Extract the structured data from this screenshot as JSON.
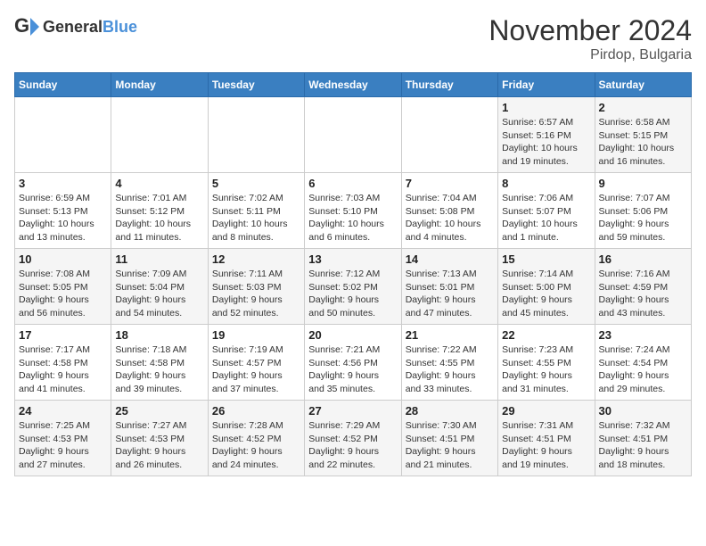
{
  "header": {
    "logo_general": "General",
    "logo_blue": "Blue",
    "month": "November 2024",
    "location": "Pirdop, Bulgaria"
  },
  "weekdays": [
    "Sunday",
    "Monday",
    "Tuesday",
    "Wednesday",
    "Thursday",
    "Friday",
    "Saturday"
  ],
  "weeks": [
    [
      {
        "day": "",
        "info": ""
      },
      {
        "day": "",
        "info": ""
      },
      {
        "day": "",
        "info": ""
      },
      {
        "day": "",
        "info": ""
      },
      {
        "day": "",
        "info": ""
      },
      {
        "day": "1",
        "info": "Sunrise: 6:57 AM\nSunset: 5:16 PM\nDaylight: 10 hours\nand 19 minutes."
      },
      {
        "day": "2",
        "info": "Sunrise: 6:58 AM\nSunset: 5:15 PM\nDaylight: 10 hours\nand 16 minutes."
      }
    ],
    [
      {
        "day": "3",
        "info": "Sunrise: 6:59 AM\nSunset: 5:13 PM\nDaylight: 10 hours\nand 13 minutes."
      },
      {
        "day": "4",
        "info": "Sunrise: 7:01 AM\nSunset: 5:12 PM\nDaylight: 10 hours\nand 11 minutes."
      },
      {
        "day": "5",
        "info": "Sunrise: 7:02 AM\nSunset: 5:11 PM\nDaylight: 10 hours\nand 8 minutes."
      },
      {
        "day": "6",
        "info": "Sunrise: 7:03 AM\nSunset: 5:10 PM\nDaylight: 10 hours\nand 6 minutes."
      },
      {
        "day": "7",
        "info": "Sunrise: 7:04 AM\nSunset: 5:08 PM\nDaylight: 10 hours\nand 4 minutes."
      },
      {
        "day": "8",
        "info": "Sunrise: 7:06 AM\nSunset: 5:07 PM\nDaylight: 10 hours\nand 1 minute."
      },
      {
        "day": "9",
        "info": "Sunrise: 7:07 AM\nSunset: 5:06 PM\nDaylight: 9 hours\nand 59 minutes."
      }
    ],
    [
      {
        "day": "10",
        "info": "Sunrise: 7:08 AM\nSunset: 5:05 PM\nDaylight: 9 hours\nand 56 minutes."
      },
      {
        "day": "11",
        "info": "Sunrise: 7:09 AM\nSunset: 5:04 PM\nDaylight: 9 hours\nand 54 minutes."
      },
      {
        "day": "12",
        "info": "Sunrise: 7:11 AM\nSunset: 5:03 PM\nDaylight: 9 hours\nand 52 minutes."
      },
      {
        "day": "13",
        "info": "Sunrise: 7:12 AM\nSunset: 5:02 PM\nDaylight: 9 hours\nand 50 minutes."
      },
      {
        "day": "14",
        "info": "Sunrise: 7:13 AM\nSunset: 5:01 PM\nDaylight: 9 hours\nand 47 minutes."
      },
      {
        "day": "15",
        "info": "Sunrise: 7:14 AM\nSunset: 5:00 PM\nDaylight: 9 hours\nand 45 minutes."
      },
      {
        "day": "16",
        "info": "Sunrise: 7:16 AM\nSunset: 4:59 PM\nDaylight: 9 hours\nand 43 minutes."
      }
    ],
    [
      {
        "day": "17",
        "info": "Sunrise: 7:17 AM\nSunset: 4:58 PM\nDaylight: 9 hours\nand 41 minutes."
      },
      {
        "day": "18",
        "info": "Sunrise: 7:18 AM\nSunset: 4:58 PM\nDaylight: 9 hours\nand 39 minutes."
      },
      {
        "day": "19",
        "info": "Sunrise: 7:19 AM\nSunset: 4:57 PM\nDaylight: 9 hours\nand 37 minutes."
      },
      {
        "day": "20",
        "info": "Sunrise: 7:21 AM\nSunset: 4:56 PM\nDaylight: 9 hours\nand 35 minutes."
      },
      {
        "day": "21",
        "info": "Sunrise: 7:22 AM\nSunset: 4:55 PM\nDaylight: 9 hours\nand 33 minutes."
      },
      {
        "day": "22",
        "info": "Sunrise: 7:23 AM\nSunset: 4:55 PM\nDaylight: 9 hours\nand 31 minutes."
      },
      {
        "day": "23",
        "info": "Sunrise: 7:24 AM\nSunset: 4:54 PM\nDaylight: 9 hours\nand 29 minutes."
      }
    ],
    [
      {
        "day": "24",
        "info": "Sunrise: 7:25 AM\nSunset: 4:53 PM\nDaylight: 9 hours\nand 27 minutes."
      },
      {
        "day": "25",
        "info": "Sunrise: 7:27 AM\nSunset: 4:53 PM\nDaylight: 9 hours\nand 26 minutes."
      },
      {
        "day": "26",
        "info": "Sunrise: 7:28 AM\nSunset: 4:52 PM\nDaylight: 9 hours\nand 24 minutes."
      },
      {
        "day": "27",
        "info": "Sunrise: 7:29 AM\nSunset: 4:52 PM\nDaylight: 9 hours\nand 22 minutes."
      },
      {
        "day": "28",
        "info": "Sunrise: 7:30 AM\nSunset: 4:51 PM\nDaylight: 9 hours\nand 21 minutes."
      },
      {
        "day": "29",
        "info": "Sunrise: 7:31 AM\nSunset: 4:51 PM\nDaylight: 9 hours\nand 19 minutes."
      },
      {
        "day": "30",
        "info": "Sunrise: 7:32 AM\nSunset: 4:51 PM\nDaylight: 9 hours\nand 18 minutes."
      }
    ]
  ]
}
